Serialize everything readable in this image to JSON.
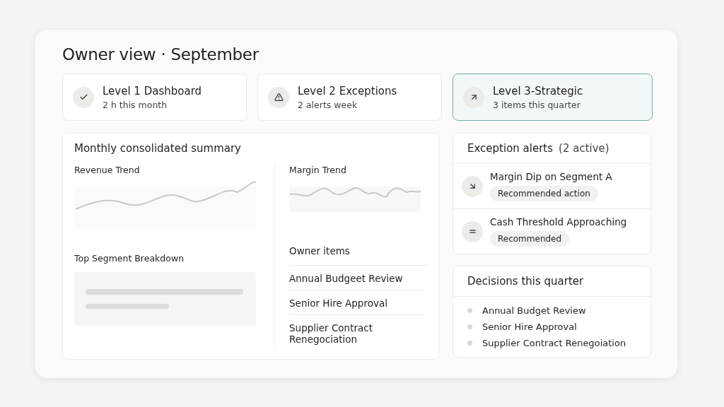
{
  "title": "Owner view · September",
  "levels": [
    {
      "title": "Level 1 Dashboard",
      "subtitle": "2 h this month",
      "selected": false
    },
    {
      "title": "Level 2 Exceptions",
      "subtitle": "2 alerts week",
      "selected": false
    },
    {
      "title": "Level 3-Strategic",
      "subtitle": "3 items this quarter",
      "selected": true
    }
  ],
  "summary": {
    "title": "Monthly consolidated summary",
    "revenue_title": "Revenue Trend",
    "margin_title": "Margin Trend",
    "segment_title": "Top Segment Breakdown",
    "owner_items_title": "Owner items",
    "owner_items": [
      "Annual Budgeet Review",
      "Senior Hire Approval",
      "Supplier Contract Renegociation"
    ]
  },
  "alerts": {
    "title": "Exception alerts",
    "count": "(2 active)",
    "items": [
      {
        "title": "Margin Dip on Segment A",
        "tag": "Recommended action"
      },
      {
        "title": "Cash Threshold Approaching",
        "tag": "Recommended"
      }
    ]
  },
  "decisions": {
    "title": "Decisions this quarter",
    "items": [
      "Annual Budget Review",
      "Senior Hire Approval",
      "Supplier Contract Renegoiation"
    ]
  }
}
